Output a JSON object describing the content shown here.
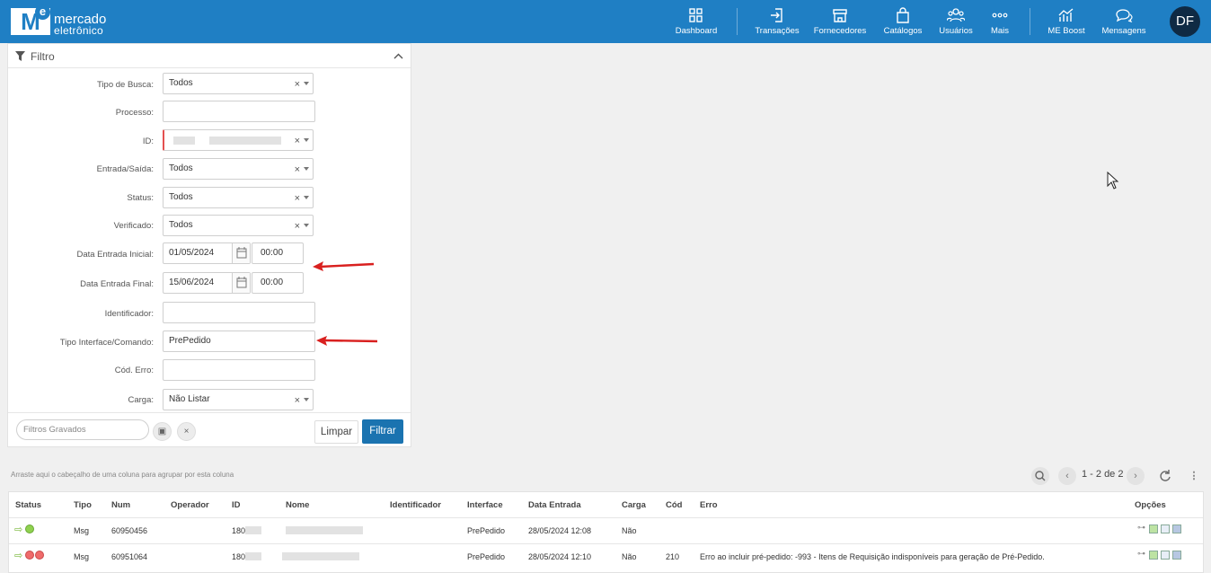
{
  "brand": {
    "mark": "M",
    "mark_sup": "e",
    "line1": "mercado",
    "line2": "eletrônico"
  },
  "nav": [
    {
      "label": "Dashboard",
      "icon": "dashboard-icon"
    },
    {
      "label": "Transações",
      "icon": "transactions-icon"
    },
    {
      "label": "Fornecedores",
      "icon": "store-icon"
    },
    {
      "label": "Catálogos",
      "icon": "bag-icon"
    },
    {
      "label": "Usuários",
      "icon": "users-icon"
    },
    {
      "label": "Mais",
      "icon": "more-icon"
    },
    {
      "label": "ME Boost",
      "icon": "chart-icon"
    },
    {
      "label": "Mensagens",
      "icon": "chat-icon"
    }
  ],
  "user": {
    "initials": "DF"
  },
  "filter": {
    "title": "Filtro",
    "fields": {
      "tipo_busca": {
        "label": "Tipo de Busca:",
        "value": "Todos"
      },
      "processo": {
        "label": "Processo:",
        "value": ""
      },
      "id": {
        "label": "ID:",
        "value": ""
      },
      "entrada_saida": {
        "label": "Entrada/Saída:",
        "value": "Todos"
      },
      "status": {
        "label": "Status:",
        "value": "Todos"
      },
      "verificado": {
        "label": "Verificado:",
        "value": "Todos"
      },
      "data_inicial": {
        "label": "Data Entrada Inicial:",
        "date": "01/05/2024",
        "time": "00:00"
      },
      "data_final": {
        "label": "Data Entrada Final:",
        "date": "15/06/2024",
        "time": "00:00"
      },
      "identificador": {
        "label": "Identificador:",
        "value": ""
      },
      "tipo_interface": {
        "label": "Tipo Interface/Comando:",
        "value": "PrePedido"
      },
      "cod_erro": {
        "label": "Cód. Erro:",
        "value": ""
      },
      "carga": {
        "label": "Carga:",
        "value": "Não Listar"
      }
    },
    "saved_placeholder": "Filtros Gravados",
    "clear_label": "Limpar",
    "filter_label": "Filtrar"
  },
  "grid": {
    "group_hint": "Arraste aqui o cabeçalho de uma coluna para agrupar por esta coluna",
    "pager": "1 - 2 de 2",
    "columns": [
      "Status",
      "Tipo",
      "Num",
      "Operador",
      "ID",
      "Nome",
      "Identificador",
      "Interface",
      "Data Entrada",
      "Carga",
      "Cód",
      "Erro",
      "Opções"
    ],
    "rows": [
      {
        "tipo": "Msg",
        "num": "60950456",
        "id": "180",
        "interface": "PrePedido",
        "data": "28/05/2024 12:08",
        "carga": "Não",
        "cod": "",
        "erro": "",
        "status": "ok"
      },
      {
        "tipo": "Msg",
        "num": "60951064",
        "id": "180",
        "interface": "PrePedido",
        "data": "28/05/2024 12:10",
        "carga": "Não",
        "cod": "210",
        "erro": "Erro ao incluir pré-pedido: -993 - Itens de Requisição indisponíveis para geração de Pré-Pedido.",
        "status": "error"
      }
    ]
  },
  "colors": {
    "topbar": "#1f7fc4",
    "primary_button": "#1a73b0",
    "annotation_arrow": "#d9201f",
    "status_ok": "#8fd14f",
    "status_error": "#ef6b6b"
  }
}
